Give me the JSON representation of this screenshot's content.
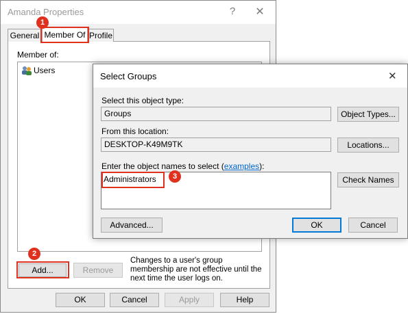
{
  "properties": {
    "title": "Amanda Properties",
    "help_glyph": "?",
    "close_glyph": "✕",
    "tabs": [
      {
        "label": "General"
      },
      {
        "label": "Member Of"
      },
      {
        "label": "Profile"
      }
    ],
    "member_of_label": "Member of:",
    "members": [
      {
        "name": "Users"
      }
    ],
    "add_label": "Add...",
    "remove_label": "Remove",
    "note": "Changes to a user's group membership are not effective until the next time the user logs on.",
    "ok_label": "OK",
    "cancel_label": "Cancel",
    "apply_label": "Apply",
    "help_label": "Help"
  },
  "select_groups": {
    "title": "Select Groups",
    "close_glyph": "✕",
    "object_type_label": "Select this object type:",
    "object_type_value": "Groups",
    "object_types_button": "Object Types...",
    "location_label": "From this location:",
    "location_value": "DESKTOP-K49M9TK",
    "locations_button": "Locations...",
    "names_label_prefix": "Enter the object names to select (",
    "names_label_link": "examples",
    "names_label_suffix": "):",
    "names_value": "Administrators",
    "check_names_button": "Check Names",
    "advanced_button": "Advanced...",
    "ok_label": "OK",
    "cancel_label": "Cancel"
  },
  "annotations": {
    "step1": "1",
    "step2": "2",
    "step3": "3",
    "highlight_color": "#e0301e"
  },
  "colors": {
    "accent": "#0078d7",
    "link": "#0066cc"
  }
}
